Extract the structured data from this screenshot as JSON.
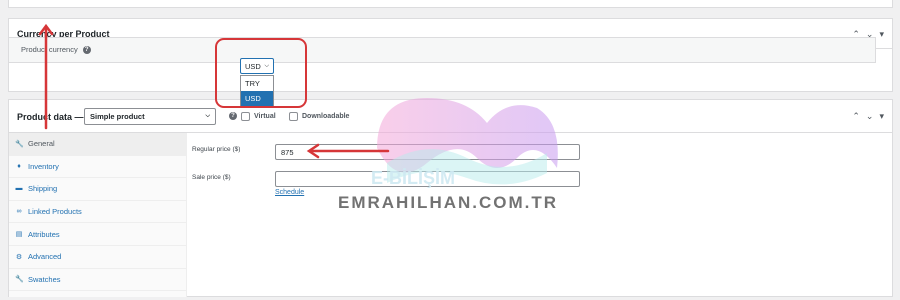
{
  "currency_box": {
    "title": "Currency per Product",
    "field_label": "Product currency",
    "selected": "USD",
    "options": [
      "TRY",
      "USD"
    ]
  },
  "product_data": {
    "title": "Product data —",
    "type_value": "Simple product",
    "virtual_label": "Virtual",
    "downloadable_label": "Downloadable",
    "tabs": [
      {
        "label": "General",
        "icon": "wrench-icon"
      },
      {
        "label": "Inventory",
        "icon": "tag-icon"
      },
      {
        "label": "Shipping",
        "icon": "truck-icon"
      },
      {
        "label": "Linked Products",
        "icon": "link-icon"
      },
      {
        "label": "Attributes",
        "icon": "list-icon"
      },
      {
        "label": "Advanced",
        "icon": "gear-icon"
      },
      {
        "label": "Swatches",
        "icon": "wrench-icon"
      }
    ],
    "regular_price_label": "Regular price ($)",
    "regular_price_value": "875",
    "sale_price_label": "Sale price ($)",
    "sale_price_value": "",
    "schedule_label": "Schedule"
  },
  "watermark": {
    "brand": "E-BİLİŞİM",
    "site": "EMRAHILHAN.COM.TR"
  },
  "colors": {
    "accent": "#2271b1",
    "annotation": "#d63638"
  }
}
